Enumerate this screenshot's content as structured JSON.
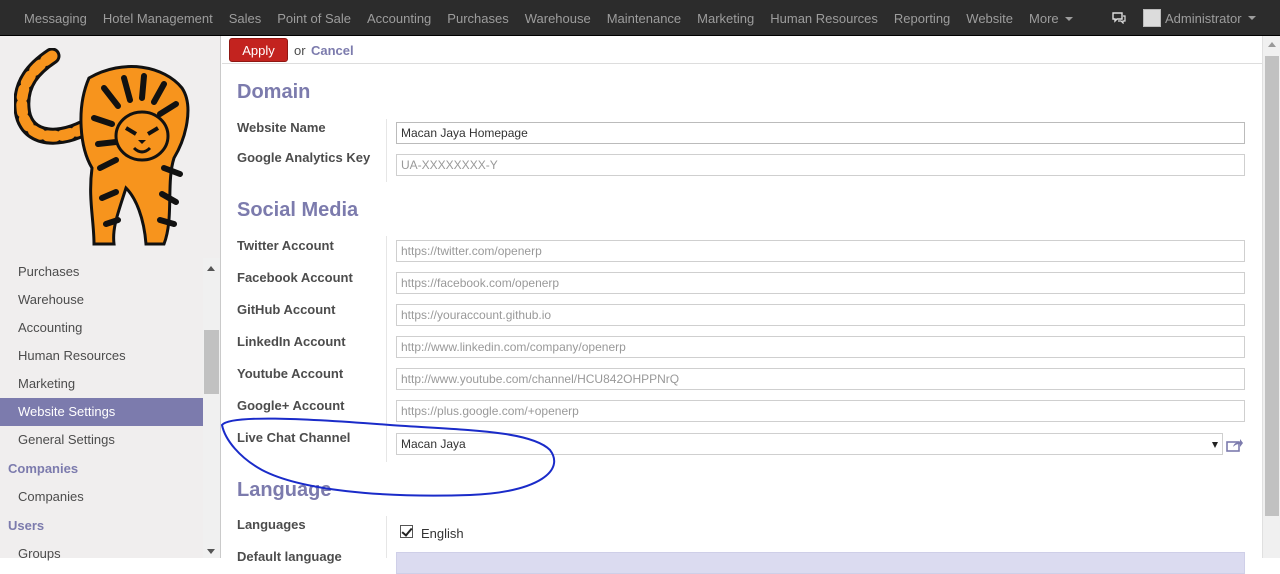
{
  "topbar": {
    "menu": [
      "Messaging",
      "Hotel Management",
      "Sales",
      "Point of Sale",
      "Accounting",
      "Purchases",
      "Warehouse",
      "Maintenance",
      "Marketing",
      "Human Resources",
      "Reporting",
      "Website"
    ],
    "more_label": "More",
    "user_name": "Administrator",
    "chat_icon": "chat-bubbles-icon"
  },
  "sidebar": {
    "items": [
      "Purchases",
      "Warehouse",
      "Accounting",
      "Human Resources",
      "Marketing",
      "Website Settings",
      "General Settings"
    ],
    "active_item": "Website Settings",
    "companies_header": "Companies",
    "companies_items": [
      "Companies"
    ],
    "users_header": "Users",
    "users_items": [
      "Groups"
    ]
  },
  "actions": {
    "apply_label": "Apply",
    "or_label": "or",
    "cancel_label": "Cancel"
  },
  "domain": {
    "title": "Domain",
    "website_name_label": "Website Name",
    "website_name_value": "Macan Jaya Homepage",
    "ga_label": "Google Analytics Key",
    "ga_placeholder": "UA-XXXXXXXX-Y"
  },
  "social": {
    "title": "Social Media",
    "twitter_label": "Twitter Account",
    "twitter_placeholder": "https://twitter.com/openerp",
    "facebook_label": "Facebook Account",
    "facebook_placeholder": "https://facebook.com/openerp",
    "github_label": "GitHub Account",
    "github_placeholder": "https://youraccount.github.io",
    "linkedin_label": "LinkedIn Account",
    "linkedin_placeholder": "http://www.linkedin.com/company/openerp",
    "youtube_label": "Youtube Account",
    "youtube_placeholder": "http://www.youtube.com/channel/HCU842OHPPNrQ",
    "gplus_label": "Google+ Account",
    "gplus_placeholder": "https://plus.google.com/+openerp",
    "livechat_label": "Live Chat Channel",
    "livechat_value": "Macan Jaya"
  },
  "language": {
    "title": "Language",
    "languages_label": "Languages",
    "english_label": "English",
    "english_checked": true,
    "default_label": "Default language"
  },
  "colors": {
    "accent": "#7c7bad",
    "apply": "#c3231f",
    "topbar": "#2c2c2c",
    "annotation": "#1a2bc9"
  }
}
